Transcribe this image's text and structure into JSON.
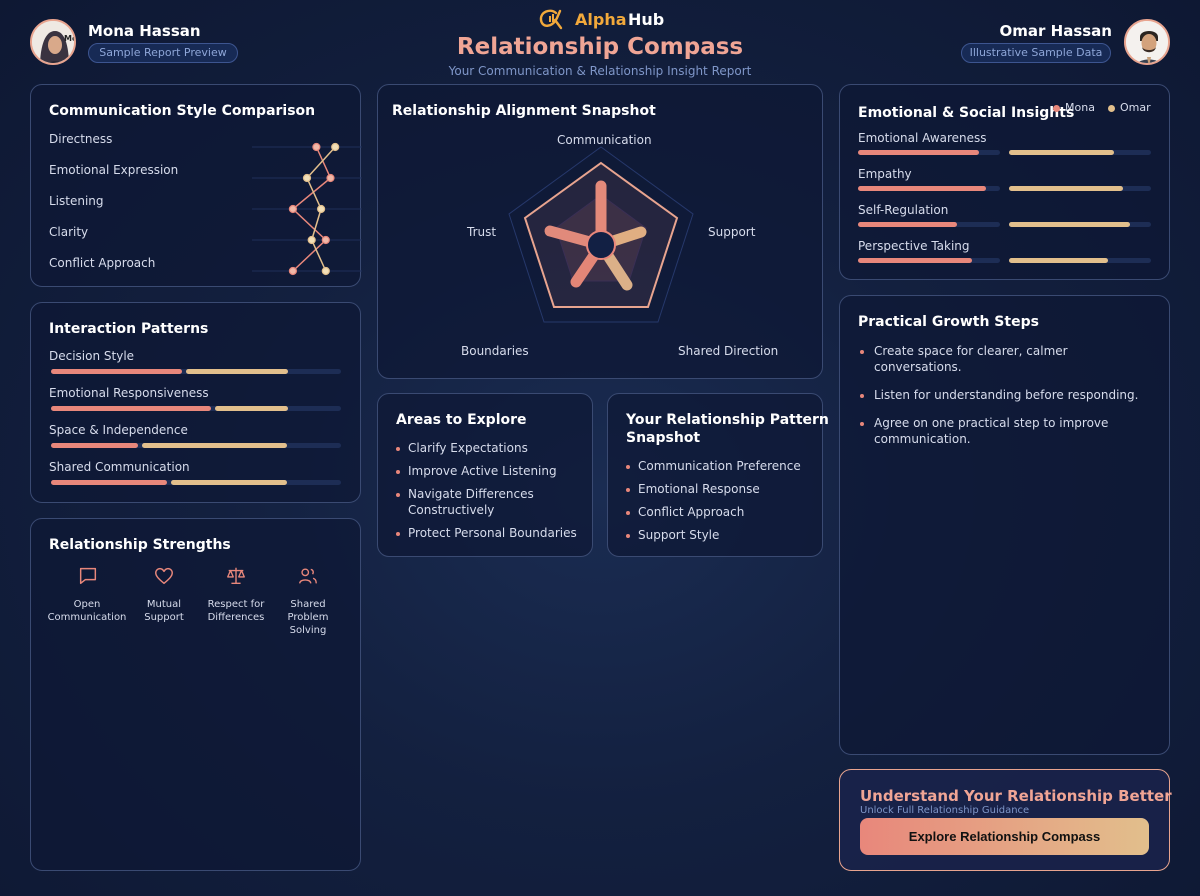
{
  "header": {
    "brand_alpha": "Alpha",
    "brand_hub": "Hub",
    "title": "Relationship Compass",
    "subtitle": "Your Communication & Relationship Insight Report",
    "left_user": {
      "name": "Mona Hassan",
      "badge": "Sample Report Preview",
      "avatar_text": "Mo"
    },
    "right_user": {
      "name": "Omar Hassan",
      "badge": "Illustrative Sample Data"
    }
  },
  "colors": {
    "mona": "#e8877b",
    "omar": "#e2bf8c",
    "accent_title": "#f0a595",
    "brand_gold": "#f2a93b"
  },
  "comm_style": {
    "title": "Communication Style Comparison",
    "rows": [
      {
        "label": "Directness",
        "mona": 0.6,
        "omar": 0.8
      },
      {
        "label": "Emotional Expression",
        "mona": 0.75,
        "omar": 0.5
      },
      {
        "label": "Listening",
        "mona": 0.35,
        "omar": 0.65
      },
      {
        "label": "Clarity",
        "mona": 0.7,
        "omar": 0.55
      },
      {
        "label": "Conflict Approach",
        "mona": 0.35,
        "omar": 0.7
      }
    ]
  },
  "interaction": {
    "title": "Interaction Patterns",
    "rows": [
      {
        "label": "Decision Style",
        "mona": 0.45,
        "omar": 0.35
      },
      {
        "label": "Emotional Responsiveness",
        "mona": 0.55,
        "omar": 0.25
      },
      {
        "label": "Space & Independence",
        "mona": 0.3,
        "omar": 0.5
      },
      {
        "label": "Shared Communication",
        "mona": 0.4,
        "omar": 0.4
      }
    ]
  },
  "strengths": {
    "title": "Relationship Strengths",
    "items": [
      {
        "label1": "Open",
        "label2": "Communication",
        "label3": "",
        "icon": "chat-bubble-icon"
      },
      {
        "label1": "Mutual",
        "label2": "Support",
        "label3": "",
        "icon": "heart-icon"
      },
      {
        "label1": "Respect for",
        "label2": "Differences",
        "label3": "",
        "icon": "balance-scale-icon"
      },
      {
        "label1": "Shared",
        "label2": "Problem",
        "label3": "Solving",
        "icon": "people-icon"
      }
    ]
  },
  "alignment": {
    "title": "Relationship Alignment Snapshot",
    "axes": [
      "Communication",
      "Support",
      "Shared Direction",
      "Boundaries",
      "Trust"
    ]
  },
  "areas": {
    "title": "Areas to Explore",
    "items": [
      "Clarify Expectations",
      "Improve Active Listening",
      "Navigate Differences Constructively",
      "Protect Personal Boundaries"
    ]
  },
  "pattern": {
    "title_line1": "Your Relationship Pattern",
    "title_line2": "Snapshot",
    "items": [
      "Communication Preference",
      "Emotional Response",
      "Conflict Approach",
      "Support Style"
    ]
  },
  "emotional": {
    "title": "Emotional & Social Insights",
    "legend_mona": "Mona",
    "legend_omar": "Omar",
    "rows": [
      {
        "label": "Emotional Awareness",
        "mona": 0.85,
        "omar": 0.74
      },
      {
        "label": "Empathy",
        "mona": 0.9,
        "omar": 0.8
      },
      {
        "label": "Self-Regulation",
        "mona": 0.7,
        "omar": 0.85
      },
      {
        "label": "Perspective Taking",
        "mona": 0.8,
        "omar": 0.7
      }
    ]
  },
  "growth": {
    "title": "Practical Growth Steps",
    "items": [
      "Create space for clearer, calmer conversations.",
      "Listen for understanding before responding.",
      "Agree on one practical step to improve communication."
    ]
  },
  "cta": {
    "title": "Understand Your Relationship Better",
    "subtitle": "Unlock Full Relationship Guidance",
    "button": "Explore Relationship Compass"
  }
}
